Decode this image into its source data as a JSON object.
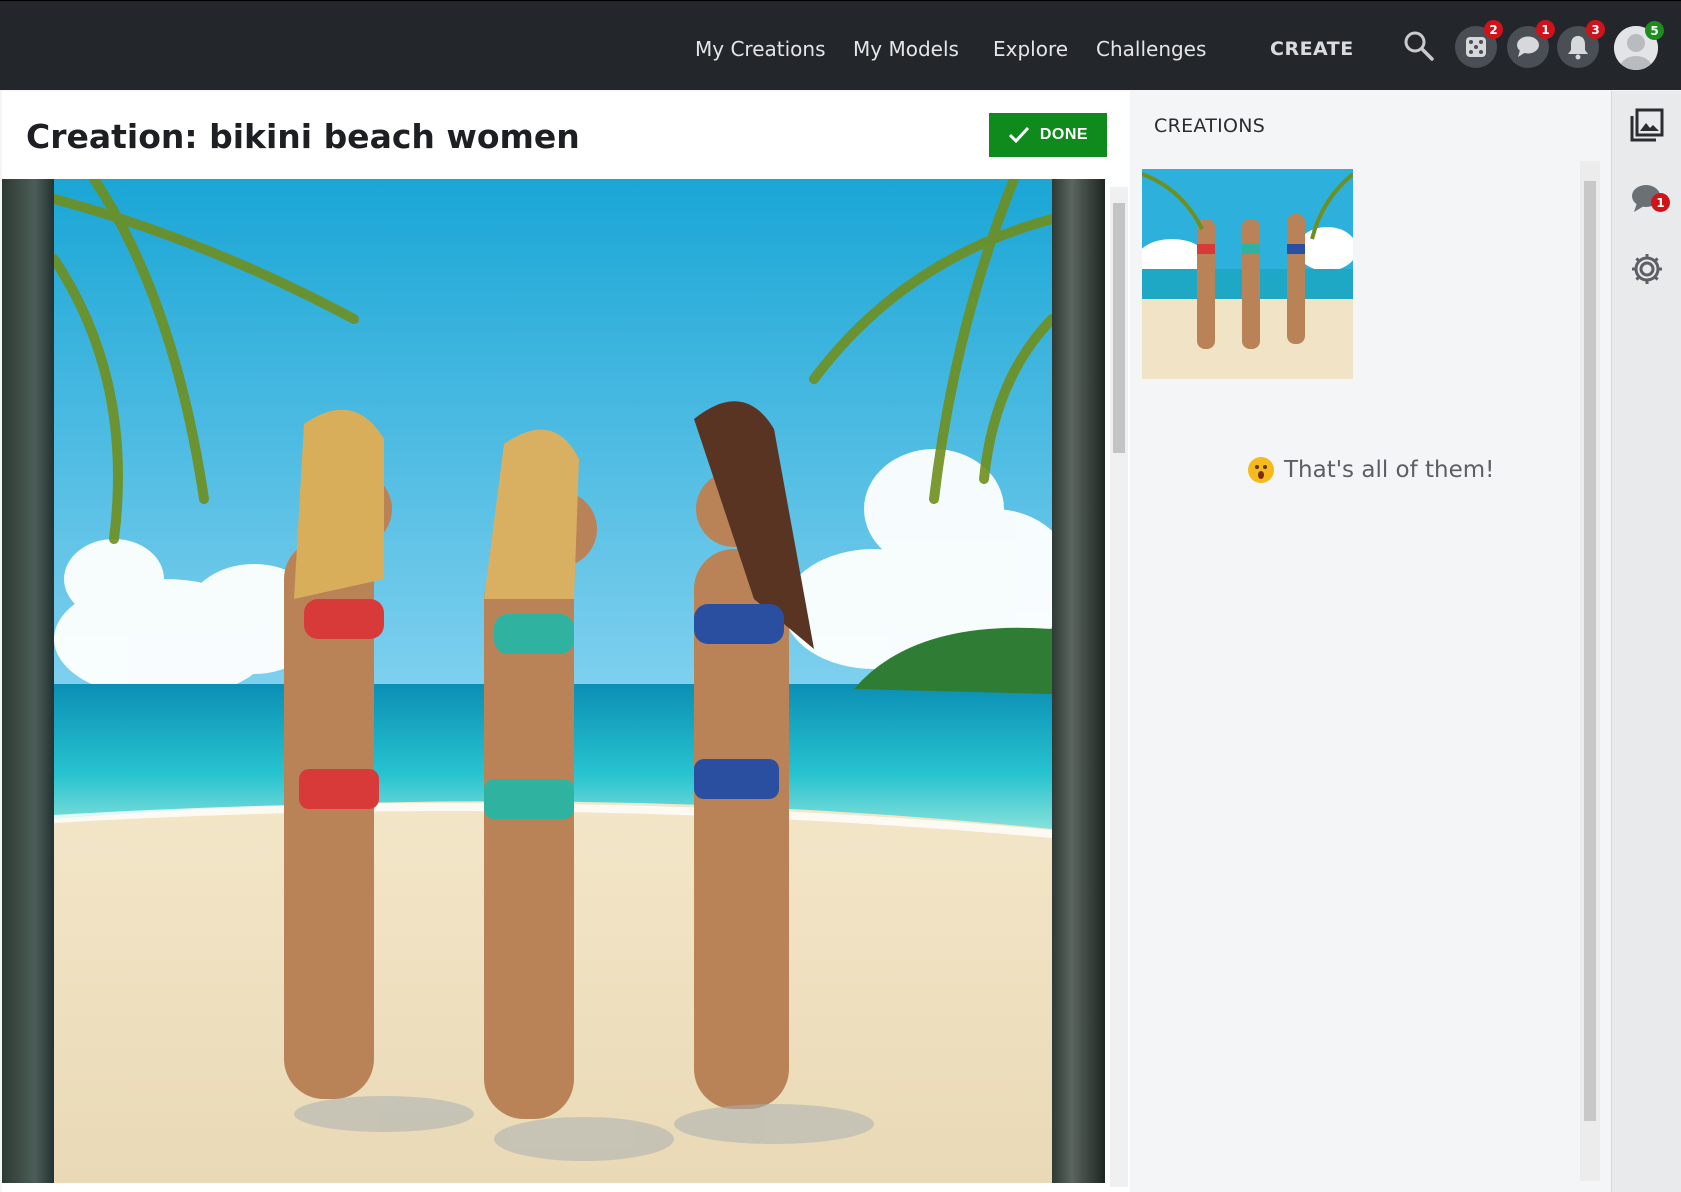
{
  "nav": {
    "links": [
      "My Creations",
      "My Models",
      "Explore",
      "Challenges"
    ],
    "create_label": "CREATE",
    "badges": {
      "dice": "2",
      "chat": "1",
      "bell": "3",
      "avatar": "5"
    }
  },
  "page": {
    "title": "Creation: bikini beach women",
    "done_label": "DONE"
  },
  "sidebar": {
    "heading": "CREATIONS",
    "end_message": "That's all of them!",
    "rail_chat_badge": "1"
  },
  "colors": {
    "topbar": "#23272b",
    "done_button": "#0f8a1c",
    "badge_red": "#d0121b",
    "badge_green": "#1e8c1e"
  },
  "icons": [
    "search-icon",
    "dice-icon",
    "chat-icon",
    "bell-icon",
    "avatar-icon",
    "checkmark-icon",
    "gallery-icon",
    "comment-icon",
    "gear-icon",
    "surprised-emoji-icon"
  ]
}
